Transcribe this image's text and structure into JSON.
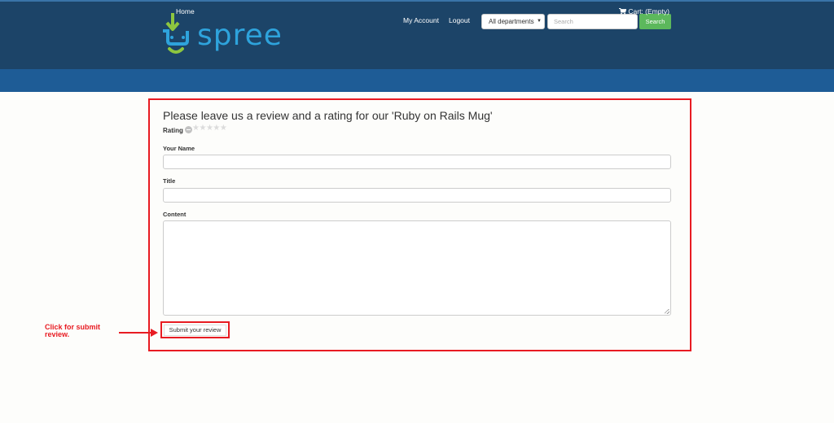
{
  "header": {
    "logo_text": "spree",
    "my_account": "My Account",
    "logout": "Logout",
    "department_select": "All departments",
    "search_placeholder": "Search",
    "search_button": "Search"
  },
  "nav": {
    "home": "Home",
    "cart_icon": "shopping-cart-icon",
    "cart": "Cart: (Empty)"
  },
  "review_form": {
    "title": "Please leave us a review and a rating for our 'Ruby on Rails Mug'",
    "rating_label": "Rating",
    "rating_value": 0,
    "rating_max": 5,
    "name_label": "Your Name",
    "name_value": "",
    "title_label": "Title",
    "title_value": "",
    "content_label": "Content",
    "content_value": "",
    "submit_label": "Submit your review"
  },
  "annotation": {
    "text": "Click for submit review.",
    "color": "#e81b22"
  },
  "colors": {
    "header_bg": "#1c4468",
    "nav_bg": "#1e5c96",
    "search_button": "#5cb85c",
    "logo_blue": "#2ea3dc",
    "logo_green": "#8dc63f"
  }
}
